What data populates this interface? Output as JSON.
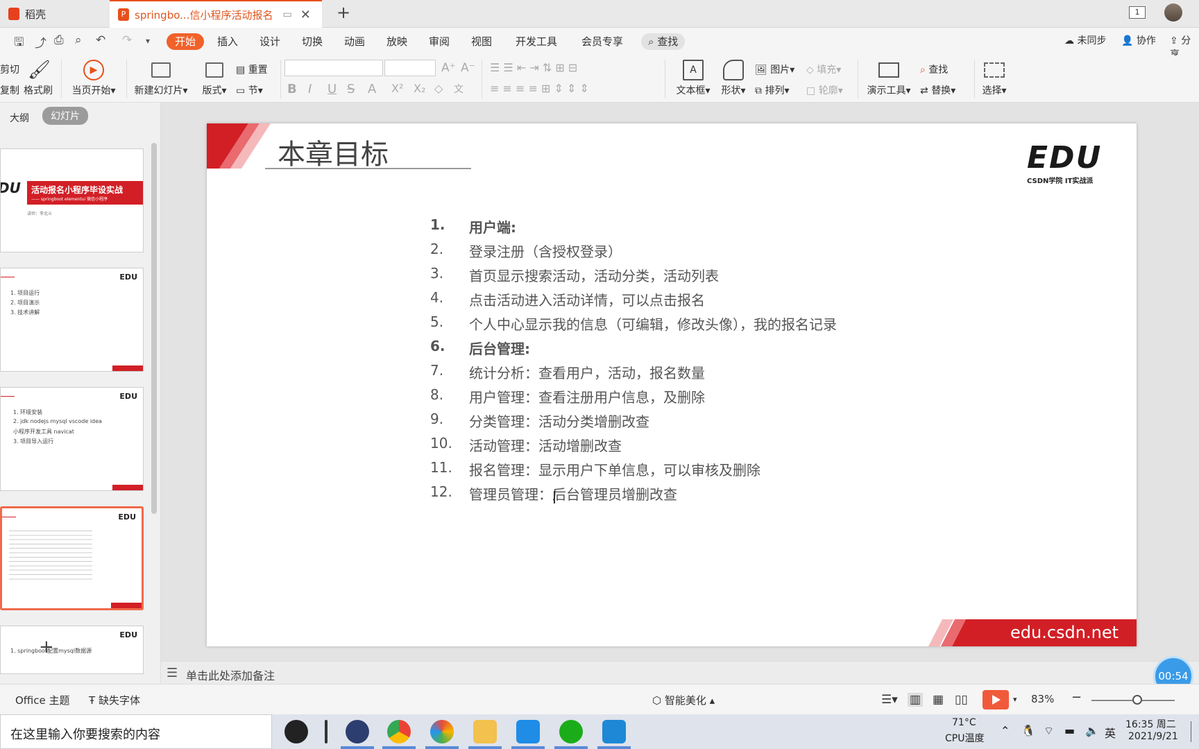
{
  "titlebar": {
    "home_tab": "稻壳",
    "doc_tab": "springbo...信小程序活动报名",
    "window_count": "1"
  },
  "menubar": {
    "items": [
      "开始",
      "插入",
      "设计",
      "切换",
      "动画",
      "放映",
      "审阅",
      "视图",
      "开发工具",
      "会员专享"
    ],
    "search": "查找",
    "sync": "未同步",
    "collab": "协作",
    "share": "分享"
  },
  "ribbon": {
    "cut": "剪切",
    "copy": "复制",
    "format_painter": "格式刷",
    "from_current": "当页开始",
    "new_slide": "新建幻灯片",
    "layout": "版式",
    "reset": "重置",
    "section": "节",
    "textbox": "文本框",
    "shape": "形状",
    "picture": "图片",
    "fill": "填充",
    "arrange": "排列",
    "outline": "轮廓",
    "present_tools": "演示工具",
    "find": "查找",
    "replace": "替换",
    "select": "选择"
  },
  "leftpanel": {
    "outline_tab": "大纲",
    "slides_tab": "幻灯片",
    "thumb1_title": "活动报名小程序毕设实战",
    "thumb1_sub": "—— springboot elementui 微信小程序",
    "thumb1_author": "讲师：李北斗",
    "thumb2_lines": [
      "1. 项目运行",
      "2. 项目演示",
      "3. 技术讲解"
    ],
    "thumb3_lines": [
      "1. 环境安装",
      "2. jdk nodejs mysql vscode idea",
      "   小程序开发工具 navicat",
      "3. 项目导入运行"
    ],
    "thumb5_lines": [
      "1. springboot配置mysql数据源"
    ],
    "edu_label": "EDU"
  },
  "slide": {
    "title": "本章目标",
    "logo_main": "EDU",
    "logo_sub": "CSDN学院   IT实战派",
    "items": [
      {
        "num": "1.",
        "text": "用户端:"
      },
      {
        "num": "2.",
        "text": "登录注册（含授权登录）"
      },
      {
        "num": "3.",
        "text": "首页显示搜索活动，活动分类，活动列表"
      },
      {
        "num": "4.",
        "text": "点击活动进入活动详情，可以点击报名"
      },
      {
        "num": "5.",
        "text": "个人中心显示我的信息（可编辑，修改头像），我的报名记录"
      },
      {
        "num": "6.",
        "text": "后台管理:"
      },
      {
        "num": "7.",
        "text": "统计分析：查看用户，活动，报名数量"
      },
      {
        "num": "8.",
        "text": "用户管理：查看注册用户信息，及删除"
      },
      {
        "num": "9.",
        "text": "分类管理：活动分类增删改查"
      },
      {
        "num": "10.",
        "text": "活动管理：活动增删改查"
      },
      {
        "num": "11.",
        "text": "报名管理：显示用户下单信息，可以审核及删除"
      },
      {
        "num": "12.",
        "text": "管理员管理：后台管理员增删改查"
      }
    ],
    "url": "edu.csdn.net"
  },
  "notes": {
    "placeholder": "单击此处添加备注"
  },
  "timer": "00:54",
  "statusbar": {
    "theme": "Office 主题",
    "missing_fonts": "缺失字体",
    "beautify": "智能美化",
    "zoom": "83%"
  },
  "taskbar": {
    "search_placeholder": "在这里输入你要搜索的内容",
    "temperature": "71°C",
    "temp_label": "CPU温度",
    "ime": "英",
    "time": "16:35 周二",
    "date": "2021/9/21"
  },
  "colors": {
    "accent_orange": "#f0622a",
    "slide_red": "#d21f26",
    "timer_blue": "#3a9be8"
  }
}
